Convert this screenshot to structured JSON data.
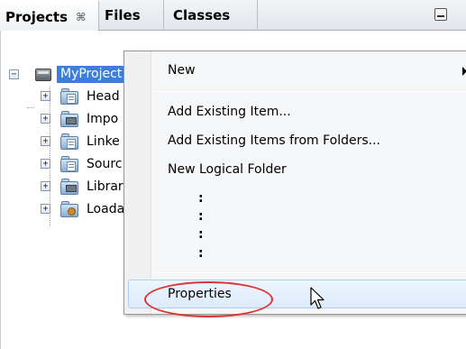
{
  "tabs": [
    {
      "label": "Projects",
      "close_glyph": "⌘"
    },
    {
      "label": "Files"
    },
    {
      "label": "Classes"
    }
  ],
  "tree": {
    "root": {
      "label": "MyProject",
      "expander": "−"
    },
    "nodes": [
      {
        "label": "Head",
        "expander": "+",
        "icon": "header-folder-icon"
      },
      {
        "label": "Impo",
        "expander": "+",
        "icon": "import-folder-icon"
      },
      {
        "label": "Linke",
        "expander": "+",
        "icon": "linked-folder-icon"
      },
      {
        "label": "Sourc",
        "expander": "+",
        "icon": "source-folder-icon"
      },
      {
        "label": "Librar",
        "expander": "+",
        "icon": "library-folder-icon"
      },
      {
        "label": "Loada",
        "expander": "+",
        "icon": "loadable-folder-icon"
      }
    ]
  },
  "context_menu": {
    "items": [
      {
        "label": "New",
        "has_submenu": true
      },
      {
        "label": "Add Existing Item..."
      },
      {
        "label": "Add Existing Items from Folders..."
      },
      {
        "label": "New Logical Folder"
      },
      {
        "label": "Properties",
        "highlighted": true
      }
    ],
    "ellipsis_dots": [
      ":",
      ":",
      ":",
      ":"
    ]
  },
  "colors": {
    "selection": "#3c7ddd",
    "annotation_ring": "#e03030",
    "hover_highlight": "#dcebfc"
  }
}
